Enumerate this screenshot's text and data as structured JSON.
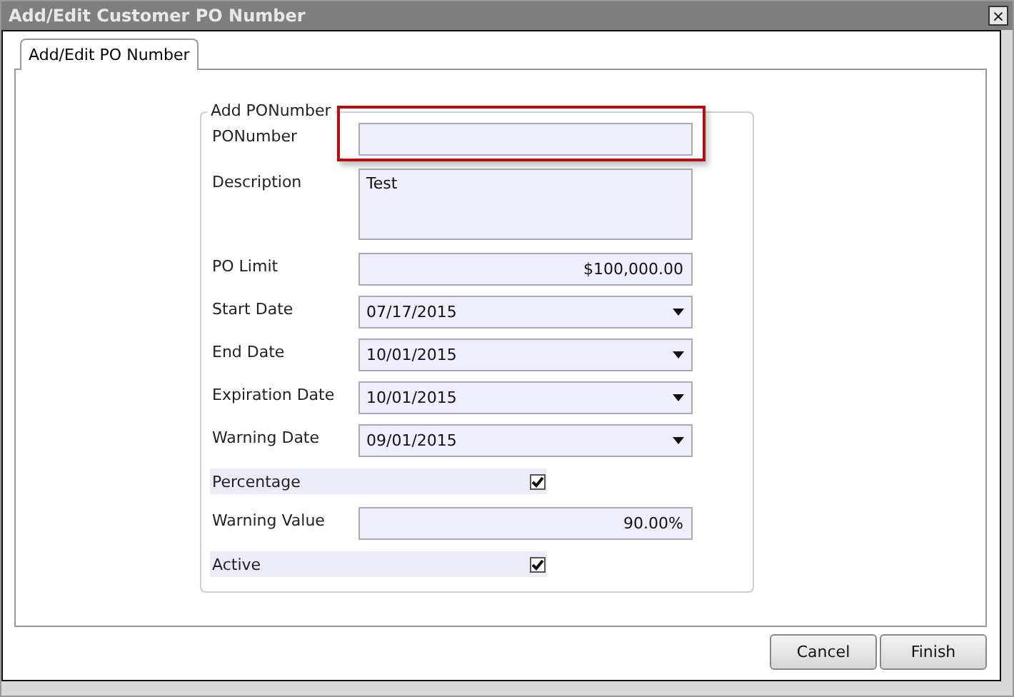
{
  "window": {
    "title": "Add/Edit Customer PO Number",
    "close": "×"
  },
  "tabs": [
    {
      "label": "Add/Edit PO Number",
      "selected": true
    }
  ],
  "group": {
    "title": "Add PONumber"
  },
  "fields": [
    {
      "kind": "text",
      "label": "PONumber",
      "highlighted": true
    },
    {
      "kind": "multiline",
      "label": "Description",
      "value": "Test",
      "highlighted": false
    },
    {
      "kind": "number",
      "label": "PO Limit",
      "value": "$100,000.00",
      "highlighted": false
    },
    {
      "kind": "dropdown",
      "label": "Start Date",
      "value": "07/17/2015",
      "highlighted": false
    },
    {
      "kind": "dropdown",
      "label": "End Date",
      "value": "10/01/2015",
      "highlighted": false
    },
    {
      "kind": "dropdown",
      "label": "Expiration Date",
      "value": "10/01/2015",
      "highlighted": false
    },
    {
      "kind": "dropdown",
      "label": "Warning Date",
      "value": "09/01/2015",
      "highlighted": false
    },
    {
      "kind": "checkbox",
      "label": "Percentage",
      "checked": true,
      "highlighted": false
    },
    {
      "kind": "number",
      "label": "Warning Value",
      "value": "90.00%",
      "highlighted": false
    },
    {
      "kind": "checkbox",
      "label": "Active",
      "checked": true,
      "highlighted": false
    }
  ],
  "buttons": [
    "Cancel",
    "Finish"
  ]
}
